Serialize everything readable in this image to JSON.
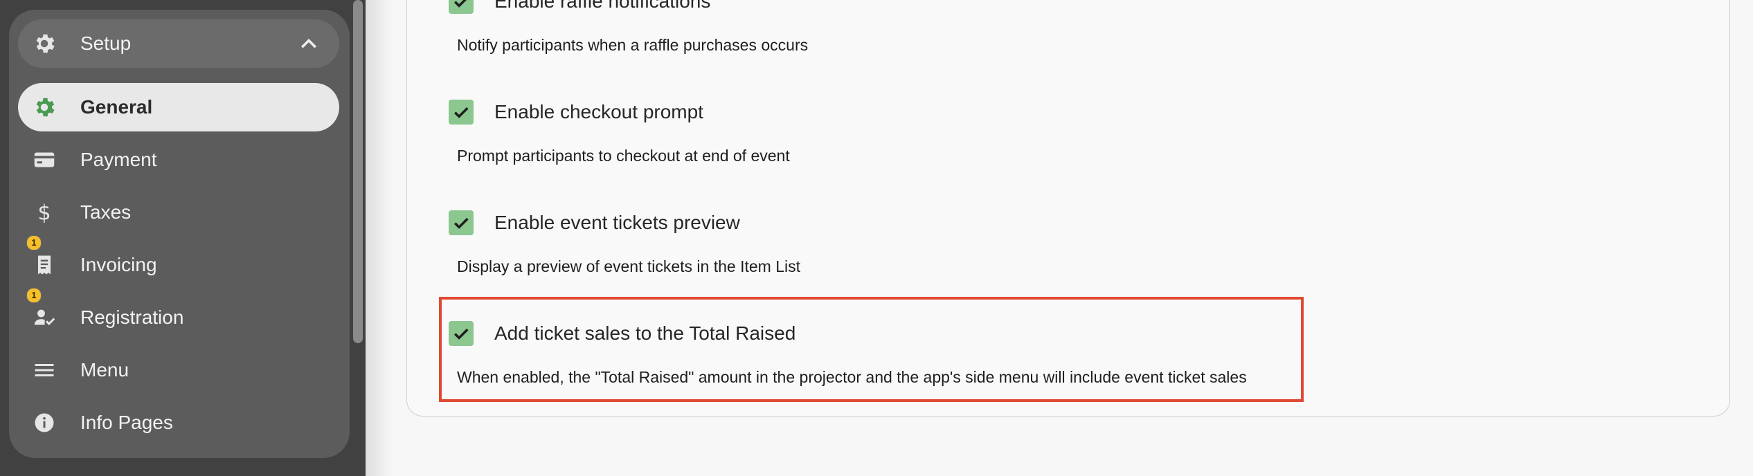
{
  "sidebar": {
    "section_header": {
      "label": "Setup",
      "icon": "gear-icon",
      "expanded": true
    },
    "items": [
      {
        "label": "General",
        "icon": "gear-icon",
        "active": true
      },
      {
        "label": "Payment",
        "icon": "credit-card-icon"
      },
      {
        "label": "Taxes",
        "icon": "dollar-icon"
      },
      {
        "label": "Invoicing",
        "icon": "receipt-icon",
        "badge": "1"
      },
      {
        "label": "Registration",
        "icon": "person-check-icon",
        "badge": "1"
      },
      {
        "label": "Menu",
        "icon": "hamburger-menu-icon"
      },
      {
        "label": "Info Pages",
        "icon": "info-icon"
      }
    ]
  },
  "settings": [
    {
      "title": "Enable raffle notifications",
      "description": "Notify participants when a raffle purchases occurs",
      "checked": true
    },
    {
      "title": "Enable checkout prompt",
      "description": "Prompt participants to checkout at end of event",
      "checked": true
    },
    {
      "title": "Enable event tickets preview",
      "description": "Display a preview of event tickets in the Item List",
      "checked": true
    },
    {
      "title": "Add ticket sales to the Total Raised",
      "description": "When enabled, the \"Total Raised\" amount in the projector and the app's side menu will include event ticket sales",
      "checked": true,
      "highlighted": true
    }
  ],
  "colors": {
    "checkbox": "#8bc78e",
    "highlight_border": "#e04a33",
    "active_icon": "#4a9a52"
  }
}
